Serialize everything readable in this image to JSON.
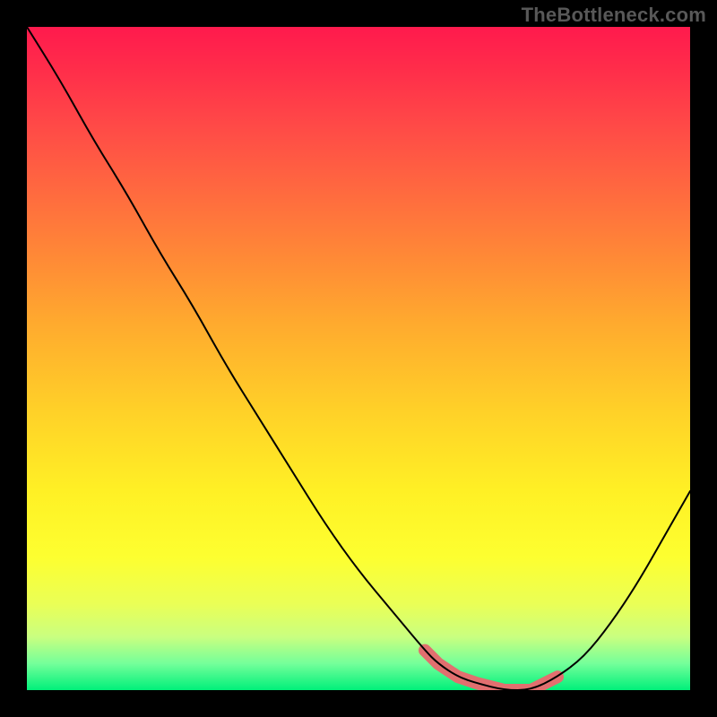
{
  "watermark": "TheBottleneck.com",
  "colors": {
    "background": "#000000",
    "watermark_text": "#585858",
    "curve": "#000000",
    "bottom_marker": "#e26f6f"
  },
  "chart_data": {
    "type": "line",
    "title": "",
    "xlabel": "",
    "ylabel": "",
    "xlim": [
      0,
      100
    ],
    "ylim": [
      0,
      100
    ],
    "x": [
      0,
      5,
      10,
      15,
      20,
      25,
      30,
      35,
      40,
      45,
      50,
      55,
      60,
      62,
      65,
      68,
      72,
      76,
      80,
      84,
      88,
      92,
      96,
      100
    ],
    "values": [
      100,
      92,
      83,
      75,
      66,
      58,
      49,
      41,
      33,
      25,
      18,
      12,
      6,
      4,
      2,
      1,
      0,
      0,
      2,
      5,
      10,
      16,
      23,
      30
    ],
    "bottom_marker_range_x": [
      60,
      82
    ],
    "notes": "Axes are unlabeled in the image; values are estimated from gridless plot. y=0 at bottom."
  }
}
